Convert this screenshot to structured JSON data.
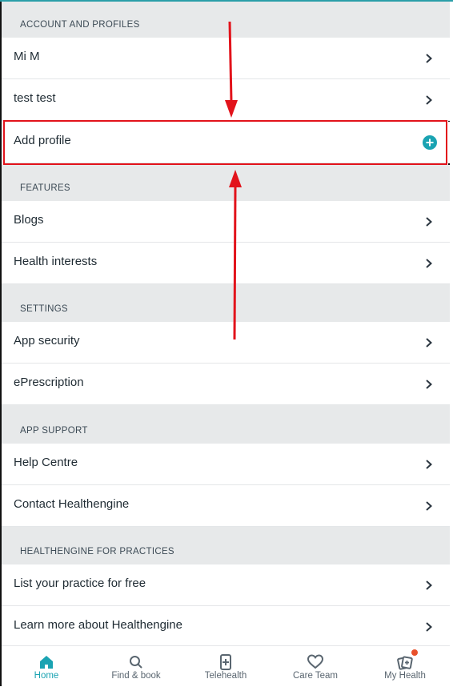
{
  "sections": [
    {
      "header": "ACCOUNT AND PROFILES",
      "items": [
        {
          "label": "Mi M"
        },
        {
          "label": "test test"
        },
        {
          "label": "Add profile"
        }
      ]
    },
    {
      "header": "FEATURES",
      "items": [
        {
          "label": "Blogs"
        },
        {
          "label": "Health interests"
        }
      ]
    },
    {
      "header": "SETTINGS",
      "items": [
        {
          "label": "App security"
        },
        {
          "label": "ePrescription"
        }
      ]
    },
    {
      "header": "APP SUPPORT",
      "items": [
        {
          "label": "Help Centre"
        },
        {
          "label": "Contact Healthengine"
        }
      ]
    },
    {
      "header": "HEALTHENGINE FOR PRACTICES",
      "items": [
        {
          "label": "List your practice for free"
        },
        {
          "label": "Learn more about Healthengine"
        }
      ]
    }
  ],
  "tabbar": [
    {
      "label": "Home",
      "icon": "home-icon",
      "active": true
    },
    {
      "label": "Find & book",
      "icon": "search-icon"
    },
    {
      "label": "Telehealth",
      "icon": "phone-medical-icon"
    },
    {
      "label": "Care Team",
      "icon": "heart-icon"
    },
    {
      "label": "My Health",
      "icon": "cards-icon",
      "badge": true
    }
  ],
  "colors": {
    "accent": "#1aa3b2",
    "annotation": "#e2131b",
    "badge": "#e8502b",
    "section_bg": "#e7e9ea"
  }
}
